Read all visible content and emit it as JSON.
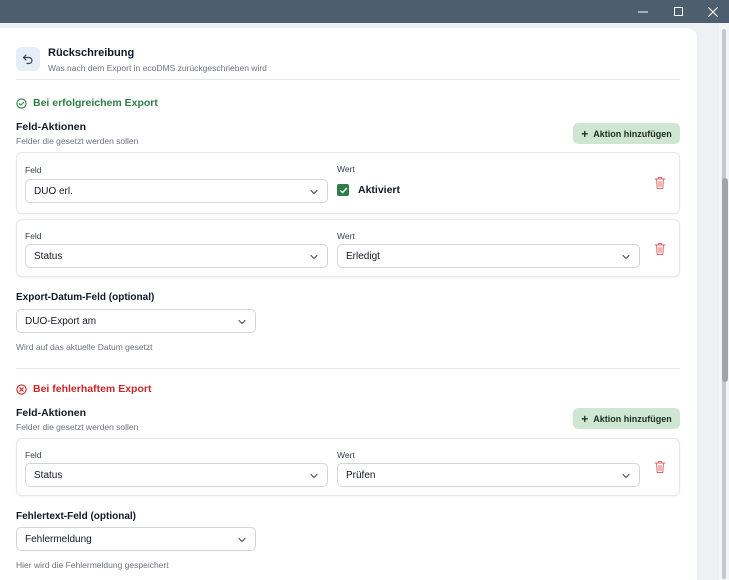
{
  "window": {
    "controls": [
      "minimize",
      "maximize",
      "close"
    ]
  },
  "header": {
    "title": "Rückschreibung",
    "subtitle": "Was nach dem Export in ecoDMS zurückgeschrieben wird"
  },
  "success": {
    "heading": "Bei erfolgreichem Export",
    "group_title": "Feld-Aktionen",
    "group_sub": "Felder die gesetzt werden sollen",
    "add_label": "Aktion hinzufügen",
    "actions": [
      {
        "field_label": "Feld",
        "field_value": "DUO erl.",
        "value_label": "Wert",
        "value": "Aktiviert",
        "value_type": "checkbox",
        "checked": true
      },
      {
        "field_label": "Feld",
        "field_value": "Status",
        "value_label": "Wert",
        "value": "Erledigt",
        "value_type": "select"
      }
    ],
    "date_field": {
      "title": "Export-Datum-Feld (optional)",
      "value": "DUO-Export am",
      "hint": "Wird auf das aktuelle Datum gesetzt"
    }
  },
  "failure": {
    "heading": "Bei fehlerhaftem Export",
    "group_title": "Feld-Aktionen",
    "group_sub": "Felder die gesetzt werden sollen",
    "add_label": "Aktion hinzufügen",
    "actions": [
      {
        "field_label": "Feld",
        "field_value": "Status",
        "value_label": "Wert",
        "value": "Prüfen",
        "value_type": "select"
      }
    ],
    "error_field": {
      "title": "Fehlertext-Feld (optional)",
      "value": "Fehlermeldung",
      "hint": "Hier wird die Fehlermeldung gespeichert"
    }
  },
  "colors": {
    "success": "#2f7d46",
    "error": "#c62828",
    "add_button_bg": "#cfe6d2",
    "titlebar": "#4d5f6f"
  }
}
